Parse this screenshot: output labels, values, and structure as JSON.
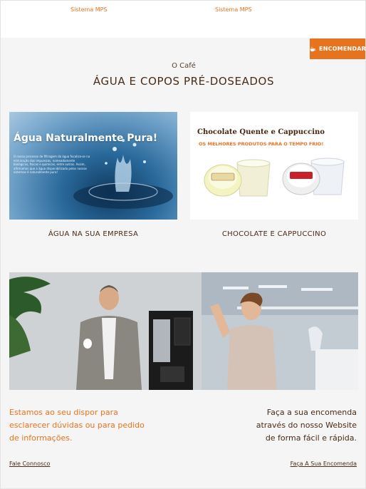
{
  "header": {
    "links": [
      "Sistema MPS",
      "Sistema MPS"
    ],
    "order_button": "ENCOMENDAR"
  },
  "section": {
    "eyebrow": "O Café",
    "title": "ÁGUA E COPOS PRÉ-DOSEADOS"
  },
  "cards": [
    {
      "caption": "ÁGUA NA SUA EMPRESA",
      "image_headline": "Água Naturalmente Pura!",
      "image_text": "O nosso processo de filtragem da água focaliza-se na eliminação das impurezas, nomeadamente biológicas, físicas e químicas, entre outras. Assim, afirmamos que a água disponibilizada pelos nossos sistemas é naturalmente pura!"
    },
    {
      "caption": "CHOCOLATE E CAPPUCCINO",
      "image_headline": "Chocolate Quente e Cappuccino",
      "image_subline": "OS MELHORES PRODUTOS PARA O TEMPO FRIO!"
    }
  ],
  "footer": {
    "left_text": "Estamos ao seu dispor para esclarecer dúvidas ou para pedido de informações.",
    "right_text": "Faça a sua encomenda através do nosso Website de forma fácil e rápida.",
    "left_link": "Fale Connosco",
    "right_link": "Faça A Sua Encomenda"
  },
  "colors": {
    "accent": "#e8731f",
    "heading": "#4a2b18",
    "background": "#f5f5f5"
  },
  "icons": {
    "order": "cup-icon"
  }
}
